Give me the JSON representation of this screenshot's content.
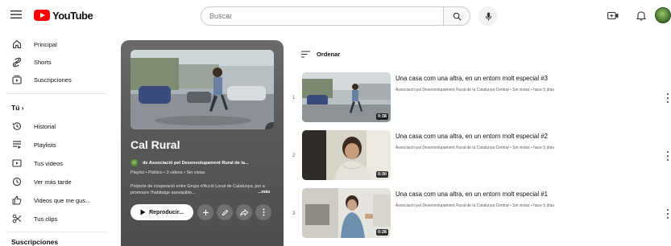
{
  "header": {
    "logo_text": "YouTube",
    "search_placeholder": "Buscar"
  },
  "sidebar": {
    "items": [
      {
        "label": "Principal",
        "icon": "home-icon"
      },
      {
        "label": "Shorts",
        "icon": "shorts-icon"
      },
      {
        "label": "Suscripciones",
        "icon": "subscriptions-icon"
      }
    ],
    "you_header": "Tú",
    "you_items": [
      {
        "label": "Historial",
        "icon": "history-icon"
      },
      {
        "label": "Playlists",
        "icon": "playlists-icon"
      },
      {
        "label": "Tus videos",
        "icon": "your-videos-icon"
      },
      {
        "label": "Ver más tarde",
        "icon": "watch-later-icon"
      },
      {
        "label": "Videos que me gus...",
        "icon": "liked-videos-icon"
      },
      {
        "label": "Tus clips",
        "icon": "clips-icon"
      }
    ],
    "subscriptions_header": "Suscripciones"
  },
  "playlist": {
    "title": "Cal Rural",
    "owner": "de Associació pel Desenvolupament Rural de la...",
    "meta": "Playlist • Público • 3 videos • Sin vistas",
    "description": "Projecte de cooperació entre Grups d'Acció Local de Catalunya, per a promoure l'habitatge assequible...",
    "more": "...más",
    "play_label": "Reproducir..."
  },
  "list": {
    "sort_label": "Ordenar",
    "videos": [
      {
        "index": "1",
        "title": "Una casa com una altra, en un entorn molt especial #3",
        "channel": "Associació pel Desenvolupament Rural de la Catalunya Central • Sin vistas • hace 5 días",
        "duration": "0:38"
      },
      {
        "index": "2",
        "title": "Una casa com una altra, en un entorn molt especial #2",
        "channel": "Associació pel Desenvolupament Rural de la Catalunya Central • Sin vistas • hace 5 días",
        "duration": "0:30"
      },
      {
        "index": "3",
        "title": "Una casa com una altra, en un entorn molt especial #1",
        "channel": "Associació pel Desenvolupament Rural de la Catalunya Central • Sin vistas • hace 5 días",
        "duration": "0:28"
      }
    ]
  },
  "colors": {
    "brand_red": "#ff0000",
    "panel_gray": "#585858"
  }
}
